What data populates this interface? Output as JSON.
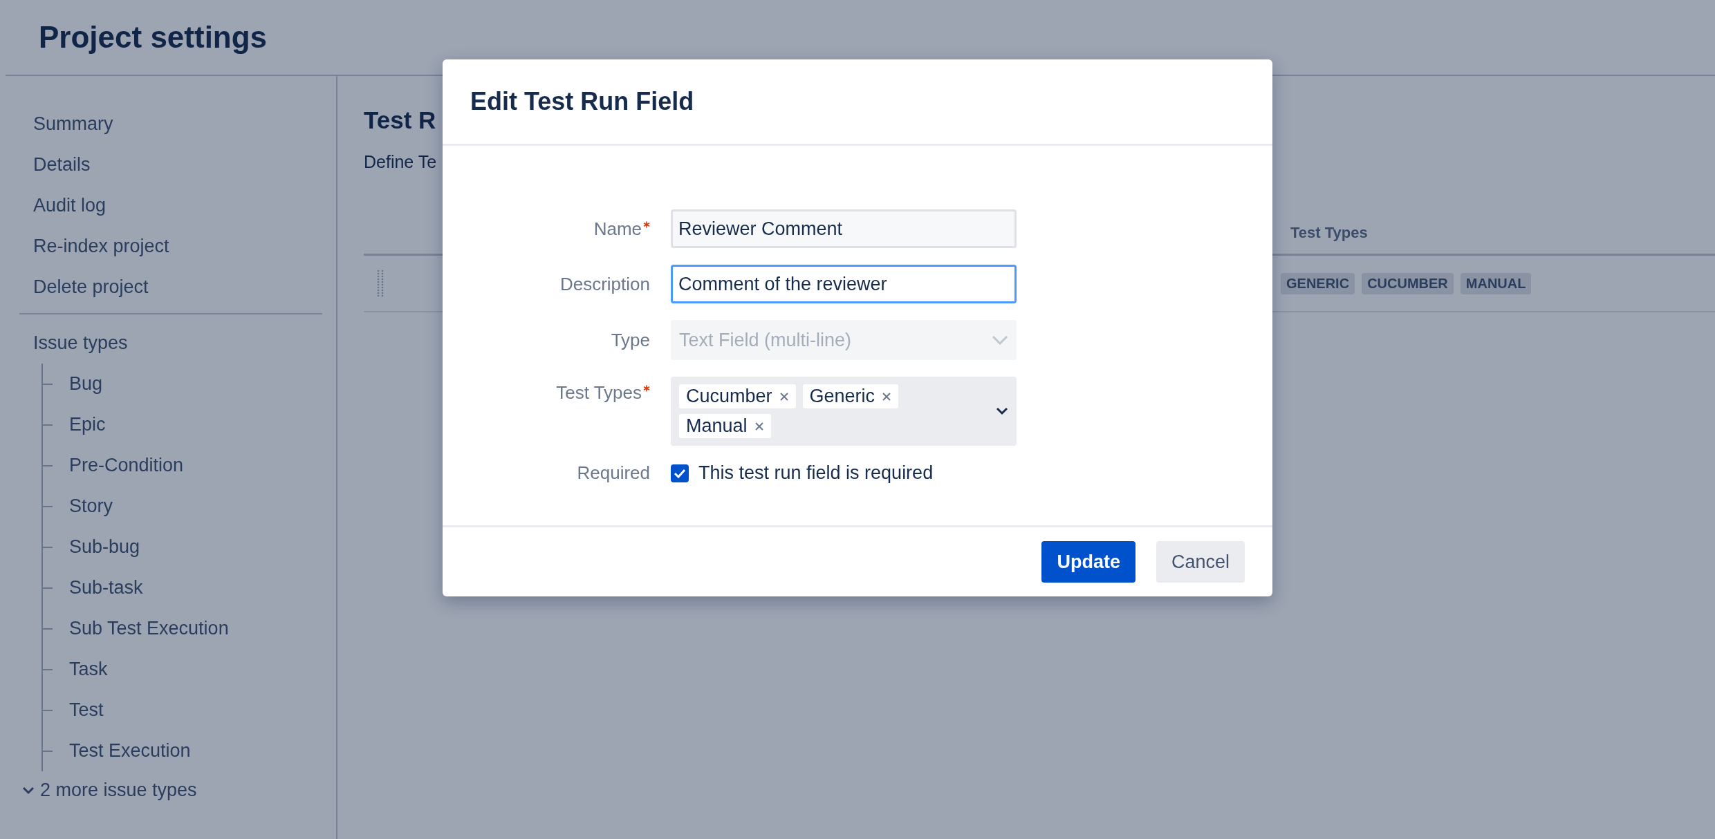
{
  "header": {
    "title": "Project settings"
  },
  "sidebar": {
    "items": [
      "Summary",
      "Details",
      "Audit log",
      "Re-index project",
      "Delete project"
    ],
    "section_title": "Issue types",
    "issue_types": [
      "Bug",
      "Epic",
      "Pre-Condition",
      "Story",
      "Sub-bug",
      "Sub-task",
      "Sub Test Execution",
      "Task",
      "Test",
      "Test Execution"
    ],
    "more_link": "2 more issue types"
  },
  "content": {
    "heading": "Test R",
    "description": "Define Te",
    "table": {
      "columns": [
        "Test Types"
      ],
      "rows": [
        {
          "test_types": [
            "GENERIC",
            "CUCUMBER",
            "MANUAL"
          ]
        }
      ]
    }
  },
  "dialog": {
    "title": "Edit Test Run Field",
    "fields": [
      {
        "kind": "text",
        "label": "Name",
        "required": true,
        "value": "Reviewer Comment",
        "focused": false
      },
      {
        "kind": "text",
        "label": "Description",
        "required": false,
        "value": "Comment of the reviewer",
        "focused": true
      },
      {
        "kind": "select",
        "label": "Type",
        "required": false,
        "value": "Text Field (multi-line)",
        "disabled": true
      },
      {
        "kind": "multiselect",
        "label": "Test Types",
        "required": true,
        "tags": [
          "Cucumber",
          "Generic",
          "Manual"
        ]
      },
      {
        "kind": "checkbox",
        "label": "Required",
        "required": false,
        "checked": true,
        "text": "This test run field is required"
      }
    ],
    "buttons": [
      {
        "label": "Update",
        "kind": "primary"
      },
      {
        "label": "Cancel",
        "kind": "secondary"
      }
    ]
  }
}
